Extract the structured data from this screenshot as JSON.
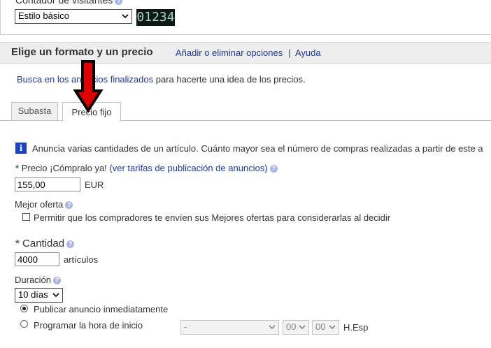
{
  "counter": {
    "label": "Contador de visitantes",
    "style_value": "Estilo básico",
    "preview_digits": "01234"
  },
  "section": {
    "title": "Elige un formato y un precio",
    "links": [
      "Añadir o eliminar opciones",
      "Ayuda"
    ],
    "separator": "|"
  },
  "tip": {
    "link_text": "Busca en los anuncios finalizados",
    "text": "para hacerte una idea de los precios."
  },
  "tabs": [
    {
      "label": "Subasta",
      "active": false
    },
    {
      "label": "Precio fijo",
      "active": true
    }
  ],
  "info": {
    "text": "Anuncia varias cantidades de un artículo. Cuánto mayor sea el número de compras realizadas a partir de este a"
  },
  "price": {
    "label": "Precio ¡Cómpralo ya!",
    "link_text": "(ver tarifas de publicación de anuncios)",
    "value": "155,00",
    "currency": "EUR"
  },
  "best_offer": {
    "label": "Mejor oferta",
    "checkbox_label": "Permitir que los compradores te envíen sus Mejores ofertas para considerarlas al decidir"
  },
  "quantity": {
    "label": "Cantidad",
    "value": "4000",
    "unit": "artículos"
  },
  "duration": {
    "label": "Duración",
    "value": "10 días"
  },
  "start": {
    "option_now": "Publicar anuncio inmediatamente",
    "option_schedule": "Programar la hora de inicio",
    "date_value": "-",
    "hour_value": "00",
    "minute_value": "00",
    "timezone": "H.Esp"
  },
  "colors": {
    "accent_link": "#1a3aa8",
    "required_star": "#3a8a3a",
    "section_bg": "#eeeeee",
    "arrow_red": "#e00000"
  }
}
